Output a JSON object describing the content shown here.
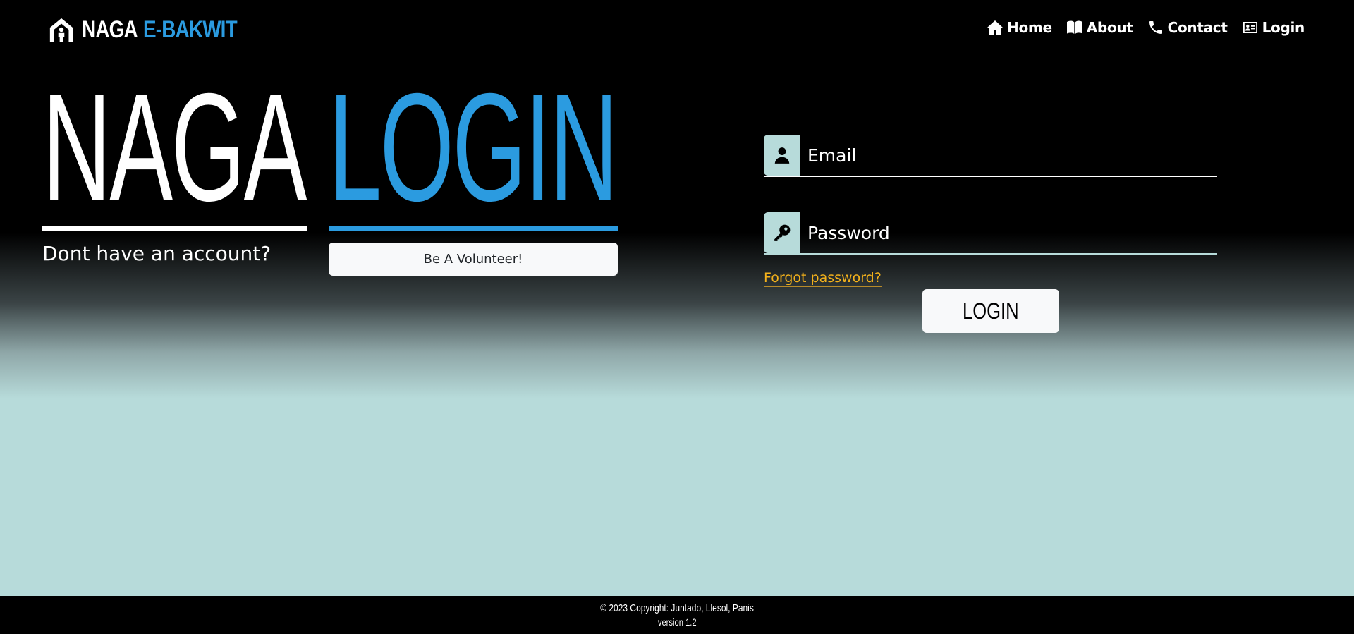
{
  "brand": {
    "white": "NAGA",
    "blue": "E-BAKWIT",
    "icon": "house-person-icon"
  },
  "nav": {
    "items": [
      {
        "label": "Home",
        "icon": "home-icon"
      },
      {
        "label": "About",
        "icon": "book-icon"
      },
      {
        "label": "Contact",
        "icon": "phone-icon"
      },
      {
        "label": "Login",
        "icon": "id-card-icon"
      }
    ]
  },
  "hero": {
    "white": "NAGA",
    "blue": "LOGIN",
    "no_account": "Dont have an account?",
    "volunteer_label": "Be A Volunteer!"
  },
  "form": {
    "email_placeholder": "Email",
    "password_placeholder": "Password",
    "forgot_label": "Forgot password?",
    "login_label": "LOGIN"
  },
  "footer": {
    "copyright": "© 2023 Copyright: Juntado, Llesol, Panis",
    "version": "version 1.2"
  },
  "colors": {
    "accent_blue": "#2b9be0",
    "light_teal": "#b7dbda",
    "link_orange": "#f5b21b"
  }
}
